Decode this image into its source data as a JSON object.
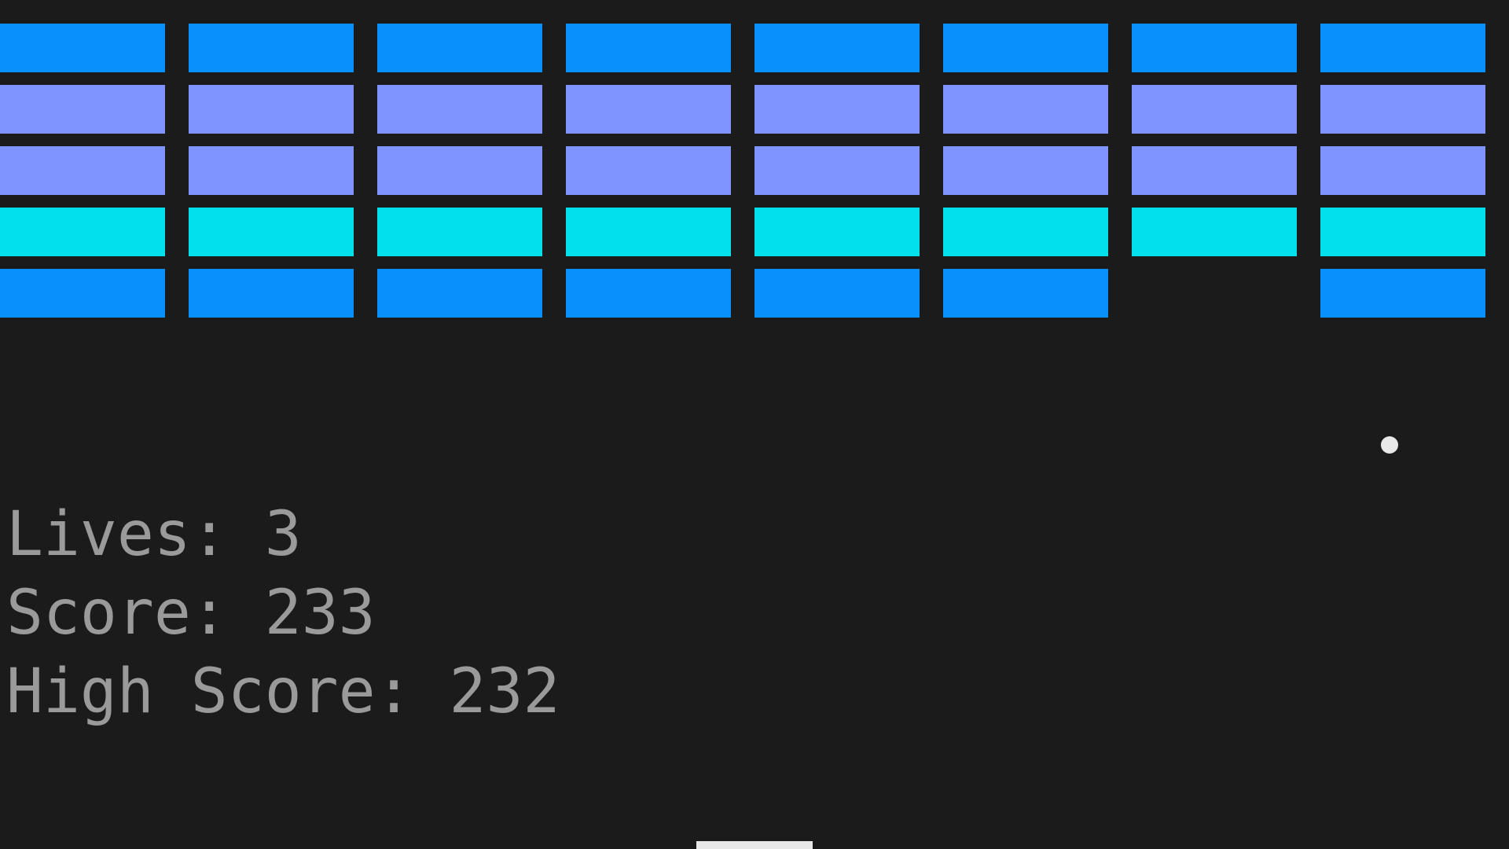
{
  "colors": {
    "background": "#1b1b1b",
    "brick_blue": "#0891fb",
    "brick_periwinkle": "#8094ff",
    "brick_cyan": "#00e1ed",
    "hud_text": "#9a9a9a",
    "ball": "#e8e8e8",
    "paddle": "#e8e8e8"
  },
  "bricks": {
    "rows": [
      {
        "color": "#0891fb",
        "present": [
          true,
          true,
          true,
          true,
          true,
          true,
          true,
          true
        ]
      },
      {
        "color": "#8094ff",
        "present": [
          true,
          true,
          true,
          true,
          true,
          true,
          true,
          true
        ]
      },
      {
        "color": "#8094ff",
        "present": [
          true,
          true,
          true,
          true,
          true,
          true,
          true,
          true
        ]
      },
      {
        "color": "#00e1ed",
        "present": [
          true,
          true,
          true,
          true,
          true,
          true,
          true,
          true
        ]
      },
      {
        "color": "#0891fb",
        "present": [
          true,
          true,
          true,
          true,
          true,
          true,
          false,
          true
        ]
      }
    ]
  },
  "hud": {
    "lives_label": "Lives: ",
    "lives": "3",
    "score_label": "Score: ",
    "score": "233",
    "high_score_label": "High Score: ",
    "high_score": "232"
  }
}
